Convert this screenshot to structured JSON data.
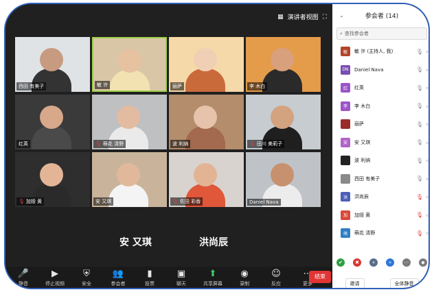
{
  "topbar": {
    "view_label": "演讲者视图"
  },
  "tiles": [
    {
      "name": "西田 有美子",
      "muted": false,
      "bg": "#dfe3e6",
      "skin": "#c79b7f",
      "shirt": "#333333"
    },
    {
      "name": "敏 许",
      "muted": false,
      "bg": "#d9c6a6",
      "skin": "#e6c2a1",
      "shirt": "#f2e2b2",
      "active": true
    },
    {
      "name": "丽萨",
      "muted": false,
      "bg": "#f6d9a8",
      "skin": "#f1cfb4",
      "shirt": "#c96a3b"
    },
    {
      "name": "李 木白",
      "muted": false,
      "bg": "#e49b4a",
      "skin": "#d8a07d",
      "shirt": "#2a2a2a"
    },
    {
      "name": "红英",
      "muted": false,
      "bg": "#3a3a3a",
      "skin": "#d7a88a",
      "shirt": "#4a4a4a"
    },
    {
      "name": "萌花 清野",
      "muted": true,
      "bg": "#bfc0c2",
      "skin": "#e3bba1",
      "shirt": "#eaeaea"
    },
    {
      "name": "波 利纳",
      "muted": false,
      "bg": "#b48d6c",
      "skin": "#e6c3aa",
      "shirt": "#a36a4f"
    },
    {
      "name": "田川 美莉子",
      "muted": true,
      "bg": "#c6ccd0",
      "skin": "#d3a27f",
      "shirt": "#1f1f1f"
    },
    {
      "name": "加娅 黄",
      "muted": true,
      "bg": "#2e2e2e",
      "skin": "#e3b596",
      "shirt": "#2a2a2a"
    },
    {
      "name": "安 又琪",
      "muted": false,
      "bg": "#c9b49b",
      "skin": "#e1b99a",
      "shirt": "#f4f4f4"
    },
    {
      "name": "佐田 彩香",
      "muted": true,
      "bg": "#d8d3cf",
      "skin": "#e3b494",
      "shirt": "#e0573a"
    },
    {
      "name": "Daniel Nava",
      "muted": false,
      "bg": "#bfc3c7",
      "skin": "#c7916f",
      "shirt": "#ececec"
    }
  ],
  "big_names": [
    "安 又琪",
    "洪尚辰"
  ],
  "toolbar": {
    "items": [
      {
        "icon": "🎤",
        "label": "静音"
      },
      {
        "icon": "▶",
        "label": "停止视频"
      },
      {
        "icon": "⛨",
        "label": "安全"
      },
      {
        "icon": "👥",
        "label": "参会者",
        "count": "14"
      },
      {
        "icon": "▮",
        "label": "投票"
      },
      {
        "icon": "▣",
        "label": "聊天"
      },
      {
        "icon": "⬆",
        "label": "共享屏幕",
        "accent": "#3fcf6d"
      },
      {
        "icon": "◉",
        "label": "录制"
      },
      {
        "icon": "☺",
        "label": "反应"
      },
      {
        "icon": "⋯",
        "label": "更多"
      }
    ],
    "end_label": "结束"
  },
  "panel": {
    "title": "参会者 (14)",
    "search_placeholder": "查找参会者",
    "participants": [
      {
        "avatar": "敏",
        "color": "#b3452b",
        "name": "敏 许 (主持人, 我)",
        "muted": false
      },
      {
        "avatar": "DN",
        "color": "#7a4fb0",
        "name": "Daniel Nava",
        "muted": false
      },
      {
        "avatar": "红",
        "color": "#9c55c8",
        "name": "红英",
        "muted": false
      },
      {
        "avatar": "李",
        "color": "#9c55c8",
        "name": "李 木白",
        "muted": false
      },
      {
        "avatar": "",
        "color": "#9b2a2a",
        "name": "丽萨",
        "muted": false
      },
      {
        "avatar": "安",
        "color": "#b064c6",
        "name": "安 又琪",
        "muted": false
      },
      {
        "avatar": "",
        "color": "#222222",
        "name": "波 利纳",
        "muted": false
      },
      {
        "avatar": "",
        "color": "#8a8a8a",
        "name": "西田 有美子",
        "muted": false
      },
      {
        "avatar": "洪",
        "color": "#4b5fb8",
        "name": "洪尚辰",
        "muted": true
      },
      {
        "avatar": "加",
        "color": "#d84a3a",
        "name": "加娅 黄",
        "muted": true
      },
      {
        "avatar": "萌",
        "color": "#2f7fc4",
        "name": "萌花 清野",
        "muted": true
      }
    ],
    "reactions": [
      {
        "icon": "✔",
        "color": "#2ea043"
      },
      {
        "icon": "✖",
        "color": "#d9352f"
      },
      {
        "icon": "«",
        "color": "#5a6c8a"
      },
      {
        "icon": "»",
        "color": "#2d77d8"
      },
      {
        "icon": "⋯",
        "color": "#7a7a7a"
      },
      {
        "icon": "◆",
        "color": "#7a7a7a"
      }
    ],
    "invite_label": "邀请",
    "mute_all_label": "全体静音"
  }
}
